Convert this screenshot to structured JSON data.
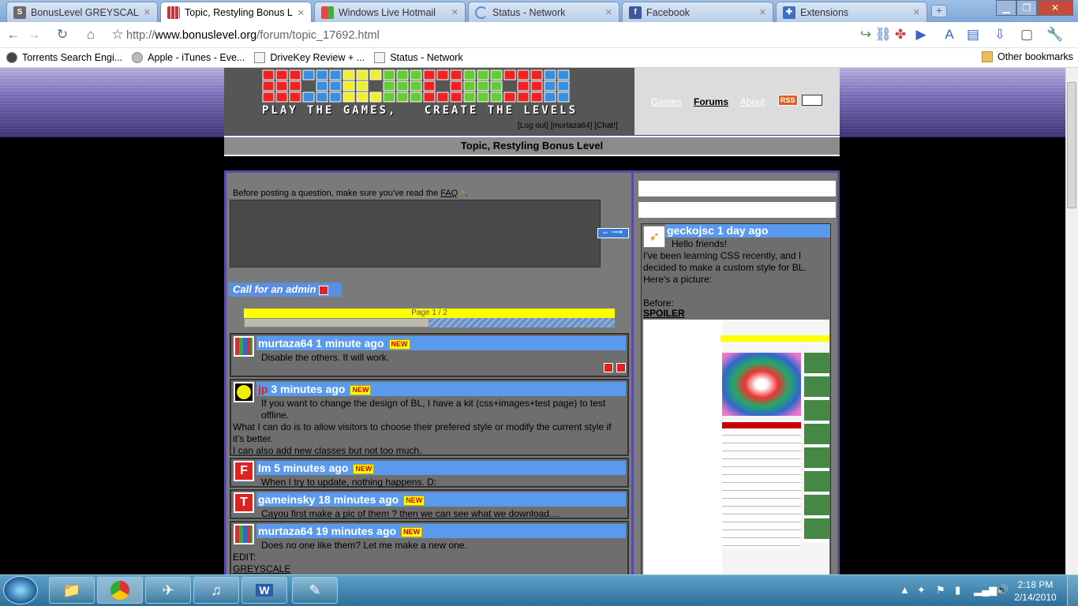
{
  "browser": {
    "tabs": [
      {
        "title": "BonusLevel GREYSCALE | ...",
        "favicon": "bonuslevel-s-icon",
        "active": false
      },
      {
        "title": "Topic, Restyling Bonus L...",
        "favicon": "bonuslevel-grid-icon",
        "active": true
      },
      {
        "title": "Windows Live Hotmail",
        "favicon": "windows-flag-icon",
        "active": false
      },
      {
        "title": "Status - Network",
        "favicon": "loading-icon",
        "active": false
      },
      {
        "title": "Facebook",
        "favicon": "facebook-icon",
        "active": false
      },
      {
        "title": "Extensions",
        "favicon": "puzzle-icon",
        "active": false
      }
    ],
    "url_prefix": "http://",
    "url_host": "www.bonuslevel.org",
    "url_path": "/forum/topic_17692.html",
    "bookmarks": [
      "Torrents Search Engi...",
      "Apple - iTunes - Eve...",
      "DriveKey Review + ...",
      "Status - Network"
    ],
    "other_bookmarks": "Other bookmarks"
  },
  "site": {
    "tagline": "PLAY THE GAMES,   CREATE THE LEVELS",
    "nav": {
      "games": "Games",
      "forums": "Forums",
      "about": "About",
      "rss": "RSS"
    },
    "account": "[Log out] [murtaza64] [Chat!]",
    "topic_title": "Topic, Restyling Bonus Level",
    "faq_text": "Before posting a question, make sure you've read the",
    "faq_link": "FAQ",
    "admin_button": "Call for an admin",
    "pager": "Page 1 / 2",
    "pager_fraction": 0.5,
    "new_badge": "NEW"
  },
  "posts": [
    {
      "author": "murtaza64",
      "time": "1 minute ago",
      "avatar": "murtaza-avatar",
      "lines": [
        "Disable the others. It will work."
      ],
      "red_author": false
    },
    {
      "author": "jp",
      "time": "3 minutes ago",
      "avatar": "jp-avatar",
      "lines": [
        "If you want to change the design of BL, I have a kit (css+images+test page) to test offline.",
        "What I can do is to allow visitors to choose their prefered style or modify the current style if it's better.",
        "I can also add new classes but not too much."
      ],
      "red_author": true
    },
    {
      "author": "Im",
      "time": "5 minutes ago",
      "avatar": "F",
      "lines": [
        "When I try to update, nothing happens. D:"
      ],
      "red_author": false
    },
    {
      "author": "gameinsky",
      "time": "18 minutes ago",
      "avatar": "T",
      "lines": [
        "Cayou first make a pic of them ? then we can see what we download...."
      ],
      "red_author": false
    },
    {
      "author": "murtaza64",
      "time": "19 minutes ago",
      "avatar": "murtaza-avatar",
      "lines": [
        "Does no one like them? Let me make a new one.",
        "EDIT:",
        "GREYSCALE"
      ],
      "red_author": false
    }
  ],
  "sidebar": {
    "author": "geckojsc",
    "time": "1 day ago",
    "greeting": "Hello friends!",
    "text": "I've been learning CSS recently, and I decided to make a custom style for BL. Here's a picture:",
    "before": "Before:",
    "spoiler": "SPOILER"
  },
  "taskbar": {
    "time": "2:18 PM",
    "date": "2/14/2010"
  }
}
